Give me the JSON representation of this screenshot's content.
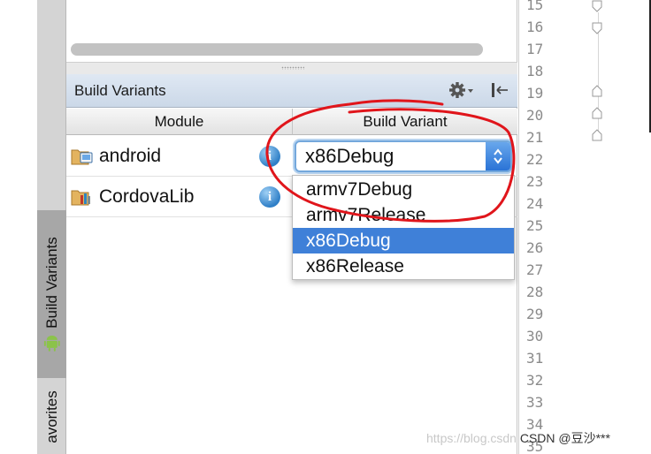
{
  "side_tabs": {
    "build_variants": "Build Variants",
    "favorites": "avorites"
  },
  "panel": {
    "title": "Build Variants",
    "columns": {
      "module": "Module",
      "build_variant": "Build Variant"
    }
  },
  "modules": [
    {
      "name": "android",
      "variant": "x86Debug",
      "icon": "android-module-icon"
    },
    {
      "name": "CordovaLib",
      "variant": "",
      "icon": "library-module-icon"
    }
  ],
  "dropdown": {
    "options": [
      "armv7Debug",
      "armv7Release",
      "x86Debug",
      "x86Release"
    ],
    "selected": "x86Debug"
  },
  "line_numbers": [
    "15",
    "16",
    "17",
    "18",
    "19",
    "20",
    "21",
    "22",
    "23",
    "24",
    "25",
    "26",
    "27",
    "28",
    "29",
    "30",
    "31",
    "32",
    "33",
    "34",
    "35"
  ],
  "watermark": {
    "url": "https://blog.csdn",
    "label": "CSDN @豆沙***"
  },
  "colors": {
    "selection": "#3f80d8",
    "annotation": "#e0151b",
    "header": "#d2deec"
  }
}
